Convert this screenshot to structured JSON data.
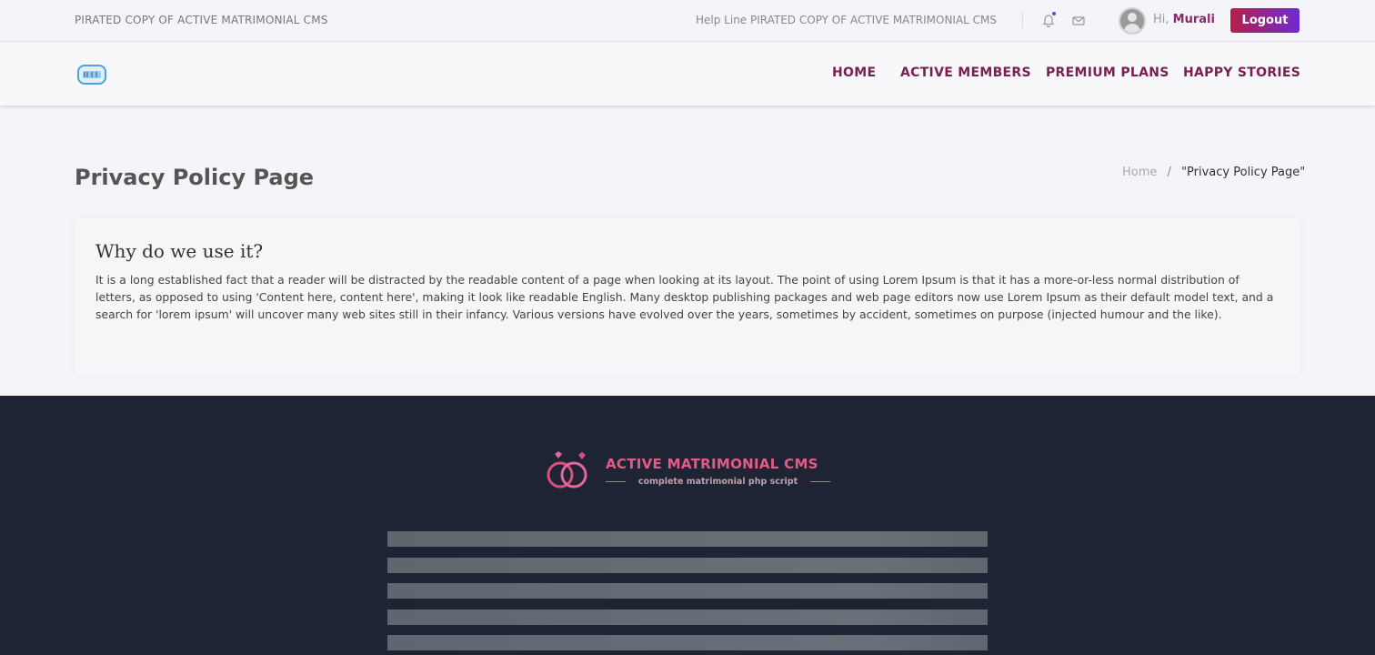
{
  "topbar": {
    "brand_text": "PIRATED COPY OF ACTIVE MATRIMONIAL CMS",
    "helpline": "Help Line PIRATED COPY OF ACTIVE MATRIMONIAL CMS",
    "greeting_prefix": "Hi,",
    "user_name": "Murali",
    "logout_label": "Logout",
    "icons": [
      "bell-icon",
      "mail-icon",
      "avatar"
    ],
    "accent": "#8e2a6c"
  },
  "nav": {
    "items": [
      {
        "label": "HOME"
      },
      {
        "label": "ACTIVE MEMBERS"
      },
      {
        "label": "PREMIUM PLANS"
      },
      {
        "label": "HAPPY STORIES"
      }
    ],
    "color": "#7a1f52"
  },
  "page": {
    "title": "Privacy Policy Page",
    "breadcrumb_home": "Home",
    "breadcrumb_separator": "/",
    "breadcrumb_current": "\"Privacy Policy Page\""
  },
  "content": {
    "heading": "Why do we use it?",
    "body": "It is a long established fact that a reader will be distracted by the readable content of a page when looking at its layout. The point of using Lorem Ipsum is that it has a more-or-less normal distribution of letters, as opposed to using 'Content here, content here', making it look like readable English. Many desktop publishing packages and web page editors now use Lorem Ipsum as their default model text, and a search for 'lorem ipsum' will uncover many web sites still in their infancy. Various versions have evolved over the years, sometimes by accident, sometimes on purpose (injected humour and the like)."
  },
  "footer": {
    "brand_title": "ACTIVE MATRIMONIAL CMS",
    "brand_subtitle": "complete matrimonial php script",
    "background": "#1f2435"
  }
}
